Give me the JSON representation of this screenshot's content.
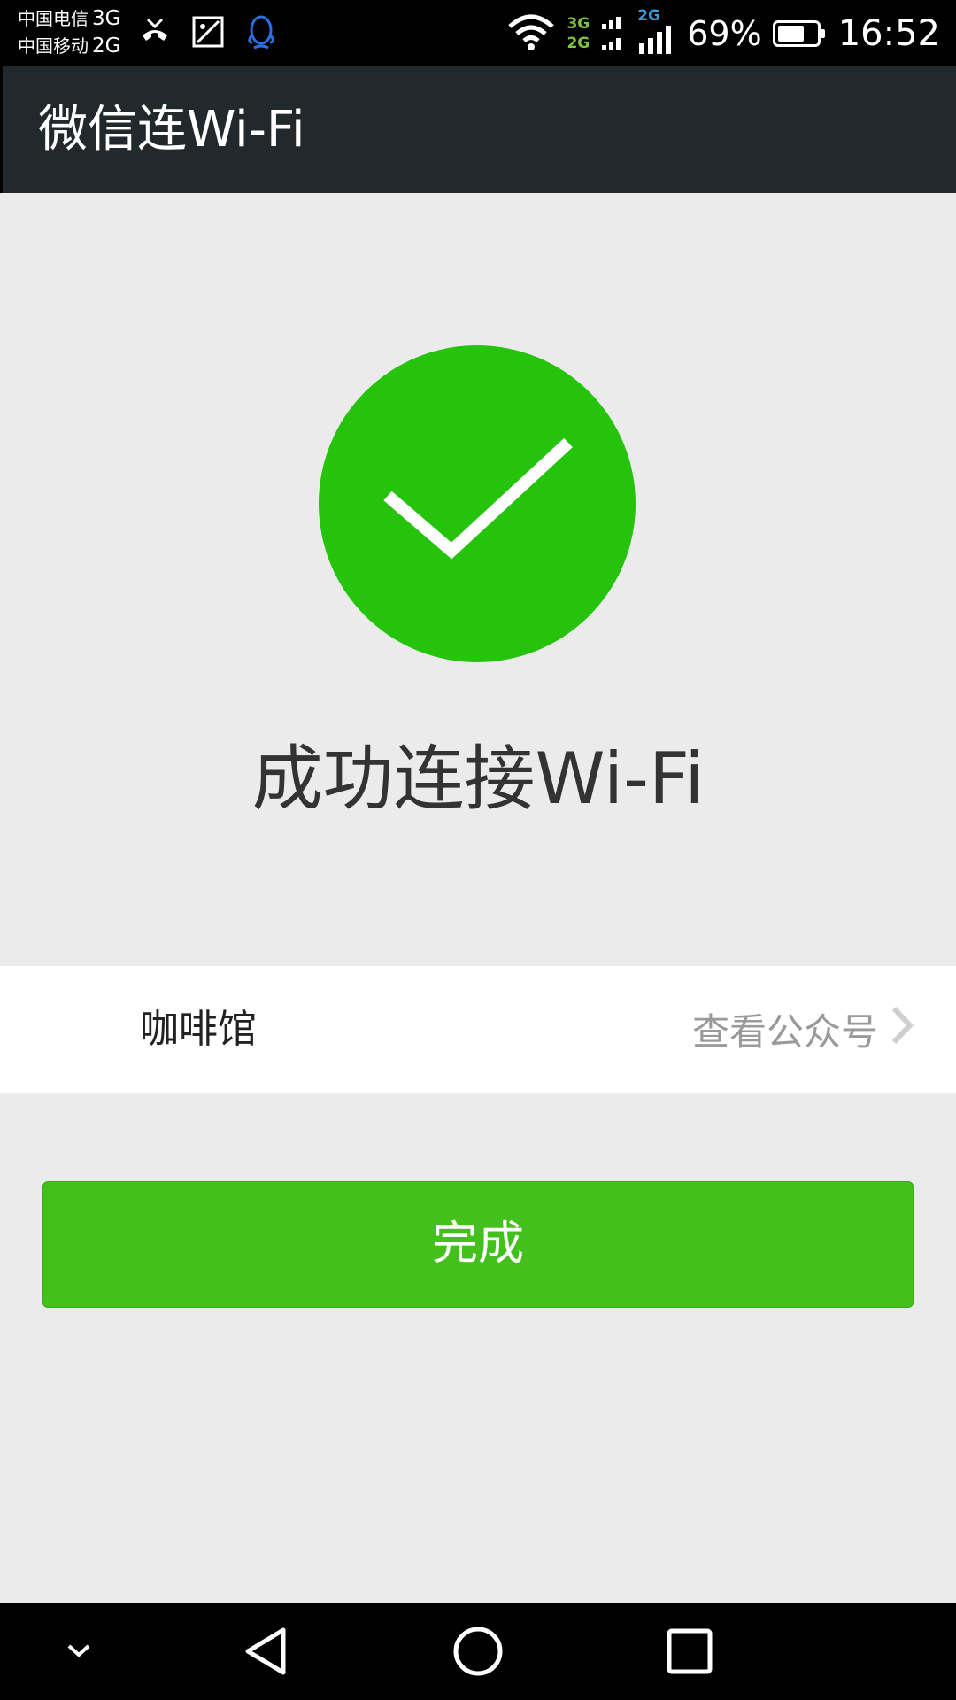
{
  "status_bar": {
    "carrier_1": "中国电信",
    "carrier_1_net": "3G",
    "carrier_2": "中国移动",
    "carrier_2_net": "2G",
    "sim1_label": "3G",
    "sim2_label": "2G",
    "cell_label": "2G",
    "battery_percent": "69%",
    "battery_level": 0.69,
    "time": "16:52",
    "icons": [
      "missed-call-icon",
      "screenshot-icon",
      "qq-icon",
      "wifi-icon",
      "signal-icon",
      "battery-icon"
    ]
  },
  "header": {
    "title": "微信连Wi-Fi"
  },
  "main": {
    "success_icon": "check-circle-icon",
    "success_color": "#26c30d",
    "headline": "成功连接Wi-Fi"
  },
  "info_row": {
    "name": "咖啡馆",
    "link_label": "查看公众号"
  },
  "actions": {
    "done_label": "完成",
    "done_color": "#44c01c"
  },
  "nav_bar": {
    "icons": [
      "chevron-down-icon",
      "back-icon",
      "home-icon",
      "recents-icon"
    ]
  }
}
